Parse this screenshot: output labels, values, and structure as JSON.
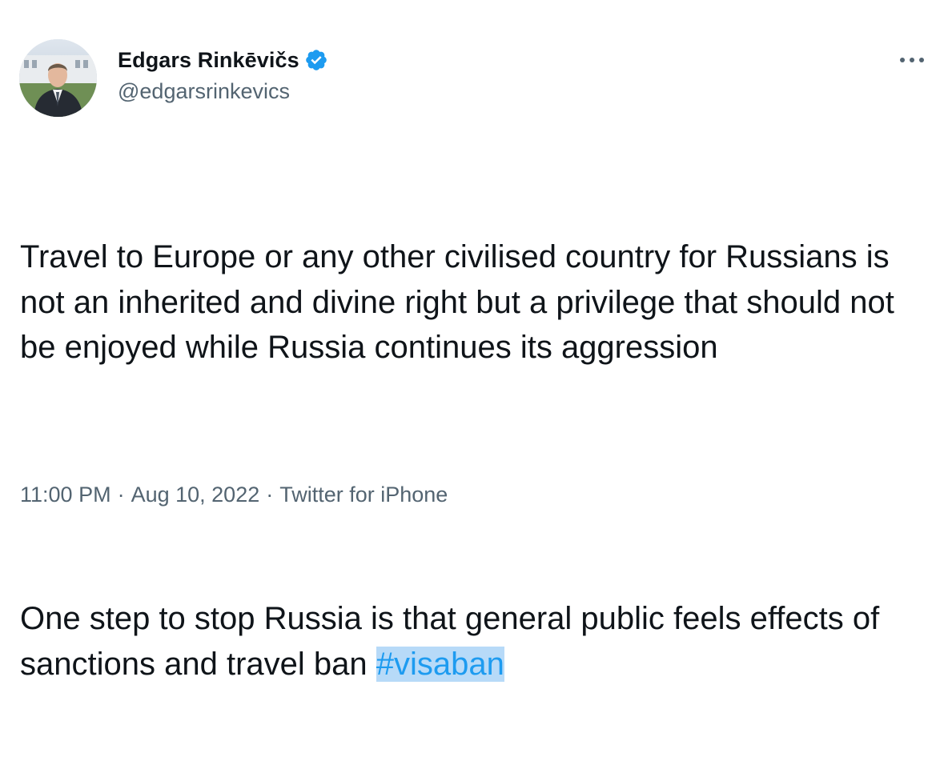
{
  "author": {
    "display_name": "Edgars Rinkēvičs",
    "handle": "@edgarsrinkevics",
    "verified": true,
    "avatar_icon": "profile-photo",
    "verified_icon": "verified-badge-icon",
    "verified_color": "#1d9bf0"
  },
  "menu": {
    "more_icon": "more-horizontal-icon"
  },
  "tweet": {
    "paragraph_1": "Travel to Europe or any other civilised country for Russians is not an inherited and divine right but a privilege that should not be enjoyed while Russia continues its aggression",
    "paragraph_2_text": "One step to stop Russia is that general public feels effects of sanctions and travel ban ",
    "hashtag": "#visaban",
    "hashtag_color": "#1d9bf0",
    "hashtag_highlight": "#b7daf8"
  },
  "meta": {
    "time": "11:00 PM",
    "date": "Aug 10, 2022",
    "source": "Twitter for iPhone",
    "separator": "·"
  }
}
